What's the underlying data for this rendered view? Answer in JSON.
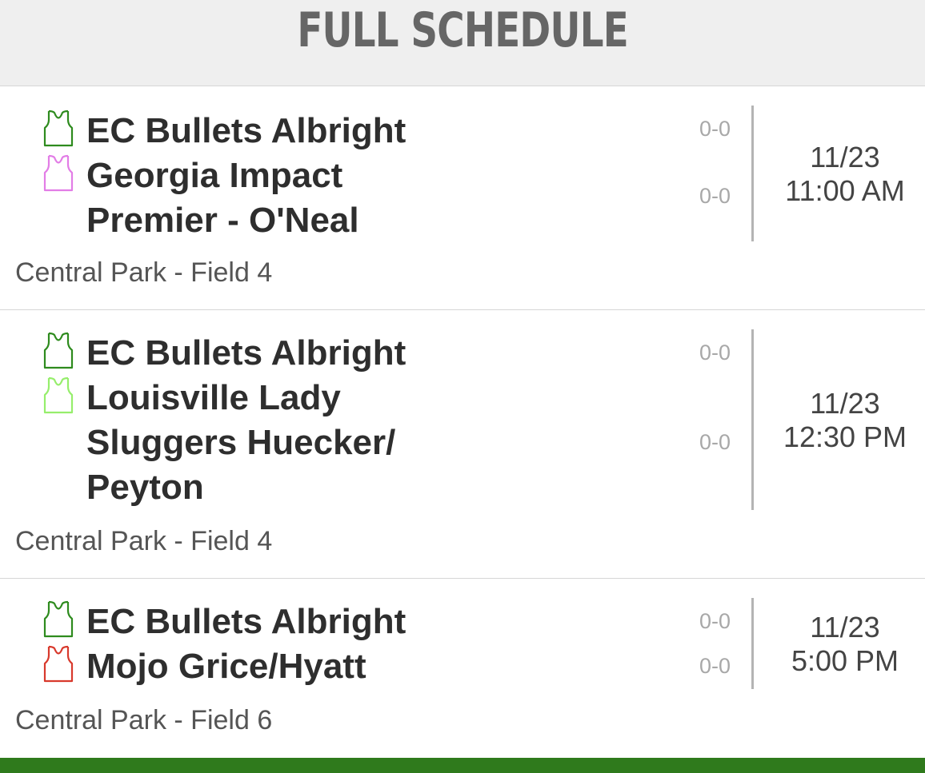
{
  "header": {
    "title": "FULL SCHEDULE"
  },
  "games": [
    {
      "teams": [
        {
          "name": "EC Bullets Albright",
          "score": "0-0",
          "jersey_color": "#2e8b1e"
        },
        {
          "name": "Georgia Impact Premier - O'Neal",
          "score": "0-0",
          "jersey_color": "#e27de6"
        }
      ],
      "date": "11/23",
      "time": "11:00 AM",
      "location": "Central Park - Field 4"
    },
    {
      "teams": [
        {
          "name": "EC Bullets Albright",
          "score": "0-0",
          "jersey_color": "#2e8b1e"
        },
        {
          "name": "Louisville Lady Sluggers Huecker/ Peyton",
          "score": "0-0",
          "jersey_color": "#96ee6c"
        }
      ],
      "date": "11/23",
      "time": "12:30 PM",
      "location": "Central Park - Field 4"
    },
    {
      "teams": [
        {
          "name": "EC Bullets Albright",
          "score": "0-0",
          "jersey_color": "#2e8b1e"
        },
        {
          "name": "Mojo Grice/Hyatt",
          "score": "0-0",
          "jersey_color": "#d8392c"
        }
      ],
      "date": "11/23",
      "time": "5:00 PM",
      "location": "Central Park - Field 6"
    }
  ],
  "icons": {
    "jersey": "jersey-icon"
  },
  "colors": {
    "footer_bar": "#2f7a1c"
  }
}
